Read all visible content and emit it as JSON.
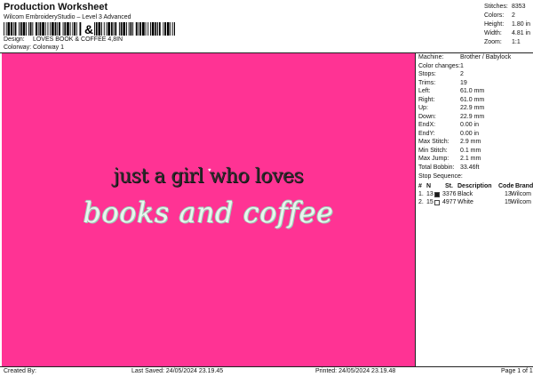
{
  "header": {
    "title": "Production Worksheet",
    "subtitle": "Wilcom EmbroideryStudio – Level 3 Advanced",
    "barcode_glyph": "&",
    "design_label": "Design:",
    "design_value": "LOVES BOOK & COFFEE 4,8IN",
    "colorway_label": "Colorway:",
    "colorway_value": "Colorway 1"
  },
  "stats": [
    {
      "label": "Stitches:",
      "value": "8353"
    },
    {
      "label": "Colors:",
      "value": "2"
    },
    {
      "label": "Height:",
      "value": "1.80 in"
    },
    {
      "label": "Width:",
      "value": "4.81 in"
    },
    {
      "label": "Zoom:",
      "value": "1:1"
    }
  ],
  "design_preview": {
    "line1": "just a girl who loves",
    "line2": "books and coffee",
    "background_color": "#ff3394"
  },
  "machine_info": [
    {
      "label": "Machine:",
      "value": "Brother / Babylock"
    },
    {
      "label": "Color changes:",
      "value": "1"
    },
    {
      "label": "Stops:",
      "value": "2"
    },
    {
      "label": "Trims:",
      "value": "19"
    },
    {
      "label": "Left:",
      "value": "61.0 mm"
    },
    {
      "label": "Right:",
      "value": "61.0 mm"
    },
    {
      "label": "Up:",
      "value": "22.9 mm"
    },
    {
      "label": "Down:",
      "value": "22.9 mm"
    },
    {
      "label": "EndX:",
      "value": "0.00 in"
    },
    {
      "label": "EndY:",
      "value": "0.00 in"
    },
    {
      "label": "Max Stitch:",
      "value": "2.9 mm"
    },
    {
      "label": "Min Stitch:",
      "value": "0.1 mm"
    },
    {
      "label": "Max Jump:",
      "value": "2.1 mm"
    },
    {
      "label": "Total Bobbin:",
      "value": "33.46ft"
    }
  ],
  "stop_sequence": {
    "title": "Stop Sequence:",
    "columns": {
      "num": "#",
      "n": "N",
      "st": "St.",
      "desc": "Description",
      "code": "Code",
      "brand": "Brand"
    },
    "rows": [
      {
        "num": "1.",
        "st": "13",
        "swatch": "#1a1a1a",
        "code": "3376",
        "desc": "Black",
        "code2": "13",
        "brand": "Wilcom"
      },
      {
        "num": "2.",
        "st": "15",
        "swatch": "#ffffff",
        "code": "4977",
        "desc": "White",
        "code2": "15",
        "brand": "Wilcom"
      }
    ]
  },
  "footer": {
    "created_by": "Created By:",
    "last_saved": "Last Saved: 24/05/2024 23.19.45",
    "printed": "Printed: 24/05/2024 23.19.48",
    "page": "Page 1 of 1"
  }
}
